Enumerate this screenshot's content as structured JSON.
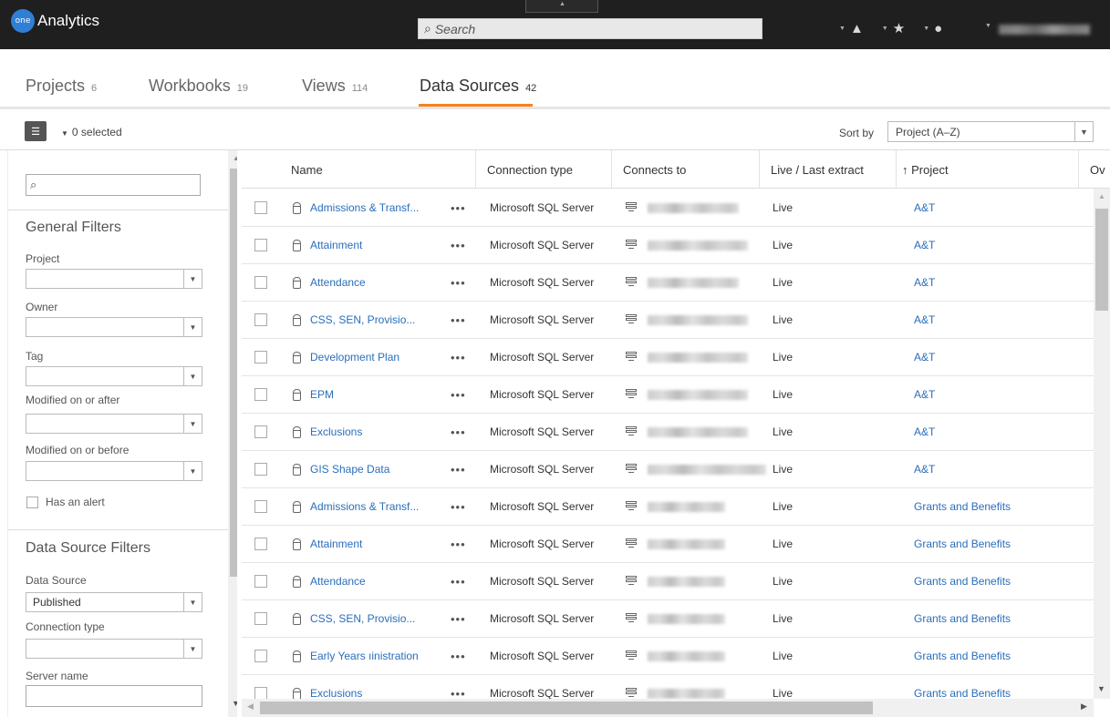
{
  "app": {
    "logo_badge": "one",
    "title": "Analytics",
    "search_placeholder": "Search",
    "search_glyph": "⌕"
  },
  "tabs": [
    {
      "label": "Projects",
      "count": "6",
      "active": false
    },
    {
      "label": "Workbooks",
      "count": "19",
      "active": false
    },
    {
      "label": "Views",
      "count": "114",
      "active": false
    },
    {
      "label": "Data Sources",
      "count": "42",
      "active": true
    }
  ],
  "toolbar": {
    "selected": "0 selected",
    "sort_by_label": "Sort by",
    "sort_value": "Project (A–Z)"
  },
  "sidebar": {
    "general_filters_heading": "General Filters",
    "project_label": "Project",
    "owner_label": "Owner",
    "tag_label": "Tag",
    "modified_after_label": "Modified on or after",
    "modified_before_label": "Modified on or before",
    "has_alert_label": "Has an alert",
    "ds_filters_heading": "Data Source Filters",
    "data_source_label": "Data Source",
    "data_source_value": "Published",
    "connection_type_label": "Connection type",
    "server_name_label": "Server name"
  },
  "table": {
    "columns": {
      "name": "Name",
      "connection_type": "Connection type",
      "connects_to": "Connects to",
      "live_last_extract": "Live / Last extract",
      "project": "↑ Project",
      "owner": "Ov"
    },
    "more_glyph": "•••",
    "rows": [
      {
        "name": "Admissions & Transf...",
        "connection": "Microsoft SQL Server",
        "live": "Live",
        "project": "A&T"
      },
      {
        "name": "Attainment",
        "connection": "Microsoft SQL Server",
        "live": "Live",
        "project": "A&T"
      },
      {
        "name": "Attendance",
        "connection": "Microsoft SQL Server",
        "live": "Live",
        "project": "A&T"
      },
      {
        "name": "CSS, SEN, Provisio...",
        "connection": "Microsoft SQL Server",
        "live": "Live",
        "project": "A&T"
      },
      {
        "name": "Development Plan",
        "connection": "Microsoft SQL Server",
        "live": "Live",
        "project": "A&T"
      },
      {
        "name": "EPM",
        "connection": "Microsoft SQL Server",
        "live": "Live",
        "project": "A&T"
      },
      {
        "name": "Exclusions",
        "connection": "Microsoft SQL Server",
        "live": "Live",
        "project": "A&T"
      },
      {
        "name": "GIS Shape Data",
        "connection": "Microsoft SQL Server",
        "live": "Live",
        "project": "A&T"
      },
      {
        "name": "Admissions & Transf...",
        "connection": "Microsoft SQL Server",
        "live": "Live",
        "project": "Grants and Benefits"
      },
      {
        "name": "Attainment",
        "connection": "Microsoft SQL Server",
        "live": "Live",
        "project": "Grants and Benefits"
      },
      {
        "name": "Attendance",
        "connection": "Microsoft SQL Server",
        "live": "Live",
        "project": "Grants and Benefits"
      },
      {
        "name": "CSS, SEN, Provisio...",
        "connection": "Microsoft SQL Server",
        "live": "Live",
        "project": "Grants and Benefits"
      },
      {
        "name": "Early Years ıinistration",
        "connection": "Microsoft SQL Server",
        "live": "Live",
        "project": "Grants and Benefits"
      },
      {
        "name": "Exclusions",
        "connection": "Microsoft SQL Server",
        "live": "Live",
        "project": "Grants and Benefits"
      }
    ]
  },
  "colors": {
    "topbar_bg": "#1f1f1f",
    "active_tab_underline": "#f58220",
    "link": "#2a6ebb"
  }
}
